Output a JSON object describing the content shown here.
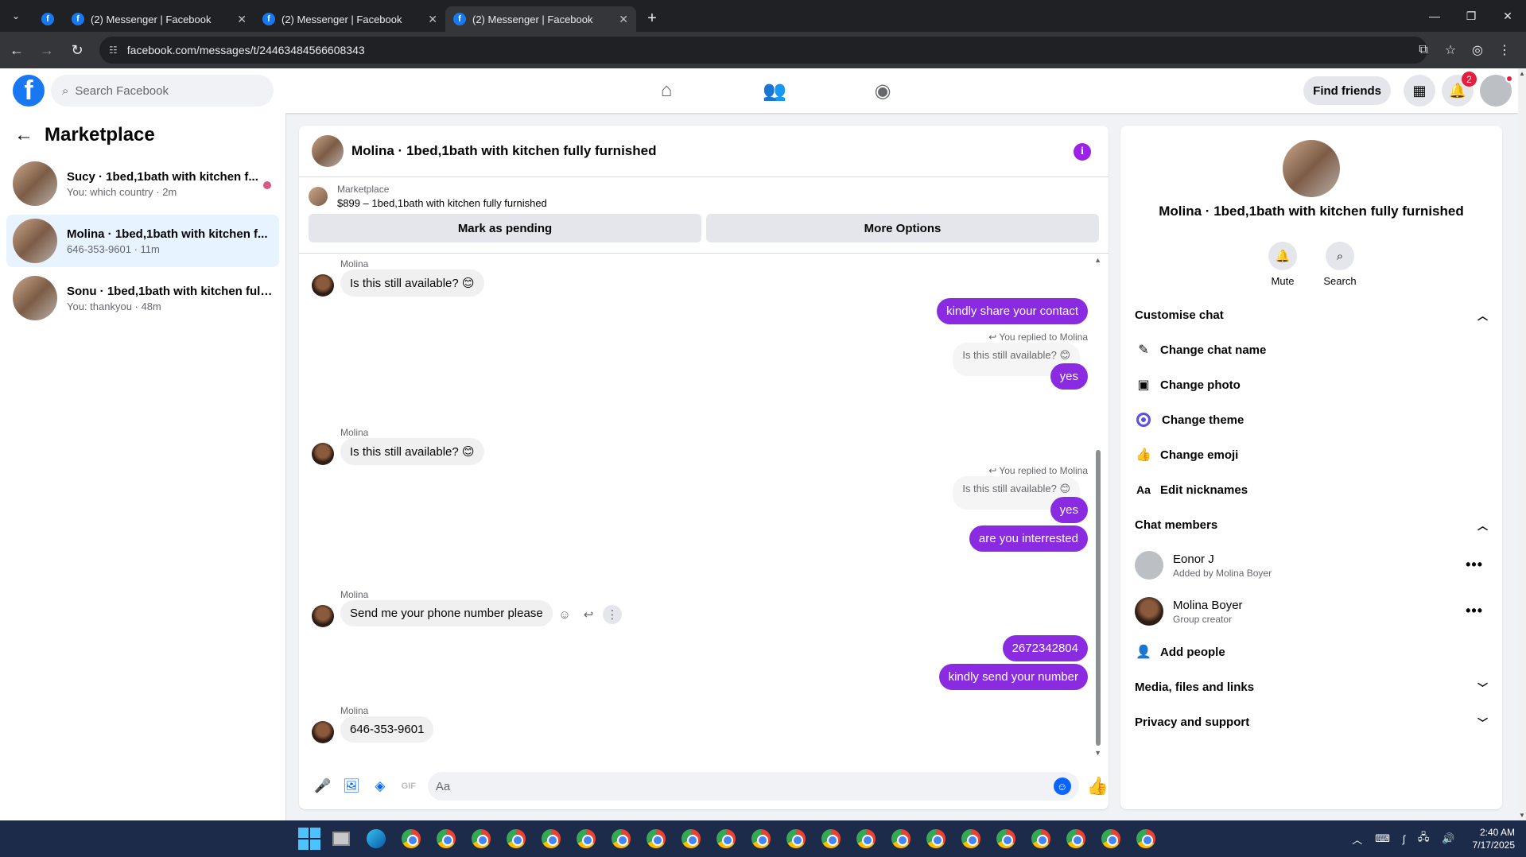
{
  "browser": {
    "tabs": [
      {
        "label": "(2) Messenger | Facebook"
      },
      {
        "label": "(2) Messenger | Facebook"
      },
      {
        "label": "(2) Messenger | Facebook"
      }
    ],
    "url": "facebook.com/messages/t/24463484566608343"
  },
  "fb": {
    "search_placeholder": "Search Facebook",
    "find_friends": "Find friends",
    "notif_count": "2"
  },
  "left": {
    "title": "Marketplace",
    "conversations": [
      {
        "name": "Sucy · 1bed,1bath with kitchen f...",
        "sub": "You: which country · 2m"
      },
      {
        "name": "Molina · 1bed,1bath with kitchen f...",
        "sub": "646-353-9601 · 11m"
      },
      {
        "name": "Sonu · 1bed,1bath with kitchen full...",
        "sub": "You: thankyou · 48m"
      }
    ]
  },
  "chat": {
    "title": "Molina · 1bed,1bath with kitchen fully furnished",
    "marketplace_label": "Marketplace",
    "listing": "$899 – 1bed,1bath with kitchen fully furnished",
    "mark_pending": "Mark as pending",
    "more_options": "More Options",
    "messages": {
      "s1": "Molina",
      "in1": "Is this still available? 😊",
      "out1": "kindly share your contact",
      "replied1": "You replied to Molina",
      "quote1": "Is this still available? 😊",
      "out2": "yes",
      "s2": "Molina",
      "in2": "Is this still available? 😊",
      "replied2": "You replied to Molina",
      "quote2": "Is this still available? 😊",
      "out3": "yes",
      "out4": "are you interrested",
      "s3": "Molina",
      "in3": "Send me your phone number please",
      "out5": "2672342804",
      "out6": "kindly send your  number",
      "s4": "Molina",
      "in4": "646-353-9601"
    },
    "composer_placeholder": "Aa"
  },
  "right": {
    "name": "Molina · 1bed,1bath with kitchen fully furnished",
    "mute": "Mute",
    "search": "Search",
    "customise": "Customise chat",
    "change_name": "Change chat name",
    "change_photo": "Change photo",
    "change_theme": "Change theme",
    "change_emoji": "Change emoji",
    "edit_nicknames": "Edit nicknames",
    "members_title": "Chat members",
    "members": [
      {
        "name": "Eonor J",
        "sub": "Added by Molina Boyer"
      },
      {
        "name": "Molina Boyer",
        "sub": "Group creator"
      }
    ],
    "add_people": "Add people",
    "media": "Media, files and links",
    "privacy": "Privacy and support"
  },
  "taskbar": {
    "time": "2:40 AM",
    "date": "7/17/2025"
  },
  "colors": {
    "fb_blue": "#1877f2",
    "out_bubble": "#8a2be2",
    "in_bubble": "#f0f0f0"
  }
}
